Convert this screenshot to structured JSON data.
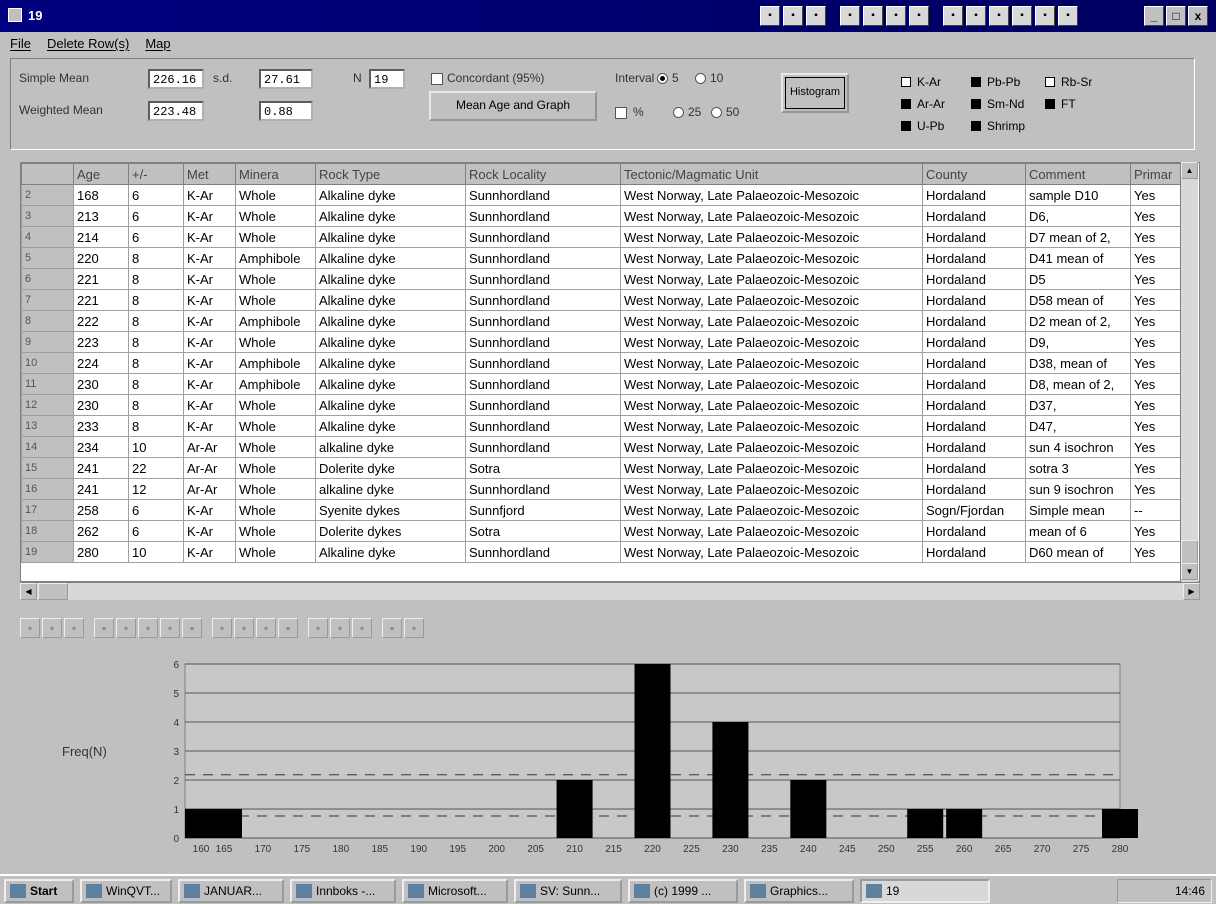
{
  "window": {
    "title": "19",
    "min_label": "_",
    "max_label": "□",
    "close_label": "x"
  },
  "title_icons": [
    "app-1-icon",
    "app-2-icon",
    "app-3-icon",
    "printer-icon",
    "sheet-icon",
    "check-icon",
    "chart-icon",
    "word-icon",
    "excel-icon",
    "doc-icon",
    "graph-icon",
    "search-icon",
    "diamond-icon"
  ],
  "menu": [
    "File",
    "Delete Row(s)",
    "Map"
  ],
  "stats": {
    "simple_mean_label": "Simple Mean",
    "simple_mean": "226.16",
    "sd_label": "s.d.",
    "sd": "27.61",
    "n_label": "N",
    "n": "19",
    "weighted_mean_label": "Weighted Mean",
    "weighted_mean": "223.48",
    "weighted_sd": "0.88",
    "concordant_label": "Concordant (95%)",
    "mean_button": "Mean Age and Graph",
    "interval_label": "Interval",
    "pct_label": "%",
    "interval_options": [
      "5",
      "10",
      "25",
      "50"
    ],
    "interval_selected": "5",
    "histogram_button": "Histogram"
  },
  "methods": [
    {
      "label": "K-Ar",
      "checked": false
    },
    {
      "label": "Pb-Pb",
      "checked": true
    },
    {
      "label": "Rb-Sr",
      "checked": false
    },
    {
      "label": "Ar-Ar",
      "checked": true
    },
    {
      "label": "Sm-Nd",
      "checked": true
    },
    {
      "label": "FT",
      "checked": true
    },
    {
      "label": "U-Pb",
      "checked": true
    },
    {
      "label": "Shrimp",
      "checked": true
    }
  ],
  "table": {
    "headers": [
      "",
      "Age",
      "+/-",
      "Met",
      "Minera",
      "Rock Type",
      "Rock Locality",
      "Tectonic/Magmatic Unit",
      "County",
      "Comment",
      "Primar"
    ],
    "rows": [
      [
        "2",
        "168",
        "6",
        "K-Ar",
        "Whole",
        "Alkaline dyke",
        "Sunnhordland",
        "West Norway, Late Palaeozoic-Mesozoic",
        "Hordaland",
        "sample D10",
        "Yes"
      ],
      [
        "3",
        "213",
        "6",
        "K-Ar",
        "Whole",
        "Alkaline dyke",
        "Sunnhordland",
        "West Norway, Late Palaeozoic-Mesozoic",
        "Hordaland",
        "D6,",
        "Yes"
      ],
      [
        "4",
        "214",
        "6",
        "K-Ar",
        "Whole",
        "Alkaline dyke",
        "Sunnhordland",
        "West Norway, Late Palaeozoic-Mesozoic",
        "Hordaland",
        "D7 mean of 2,",
        "Yes"
      ],
      [
        "5",
        "220",
        "8",
        "K-Ar",
        "Amphibole",
        "Alkaline dyke",
        "Sunnhordland",
        "West Norway, Late Palaeozoic-Mesozoic",
        "Hordaland",
        "D41 mean of",
        "Yes"
      ],
      [
        "6",
        "221",
        "8",
        "K-Ar",
        "Whole",
        "Alkaline dyke",
        "Sunnhordland",
        "West Norway, Late Palaeozoic-Mesozoic",
        "Hordaland",
        "D5",
        "Yes"
      ],
      [
        "7",
        "221",
        "8",
        "K-Ar",
        "Whole",
        "Alkaline dyke",
        "Sunnhordland",
        "West Norway, Late Palaeozoic-Mesozoic",
        "Hordaland",
        "D58 mean of",
        "Yes"
      ],
      [
        "8",
        "222",
        "8",
        "K-Ar",
        "Amphibole",
        "Alkaline dyke",
        "Sunnhordland",
        "West Norway, Late Palaeozoic-Mesozoic",
        "Hordaland",
        "D2 mean of 2,",
        "Yes"
      ],
      [
        "9",
        "223",
        "8",
        "K-Ar",
        "Whole",
        "Alkaline dyke",
        "Sunnhordland",
        "West Norway, Late Palaeozoic-Mesozoic",
        "Hordaland",
        "D9,",
        "Yes"
      ],
      [
        "10",
        "224",
        "8",
        "K-Ar",
        "Amphibole",
        "Alkaline dyke",
        "Sunnhordland",
        "West Norway, Late Palaeozoic-Mesozoic",
        "Hordaland",
        "D38, mean of",
        "Yes"
      ],
      [
        "11",
        "230",
        "8",
        "K-Ar",
        "Amphibole",
        "Alkaline dyke",
        "Sunnhordland",
        "West Norway, Late Palaeozoic-Mesozoic",
        "Hordaland",
        "D8, mean of 2,",
        "Yes"
      ],
      [
        "12",
        "230",
        "8",
        "K-Ar",
        "Whole",
        "Alkaline dyke",
        "Sunnhordland",
        "West Norway, Late Palaeozoic-Mesozoic",
        "Hordaland",
        "D37,",
        "Yes"
      ],
      [
        "13",
        "233",
        "8",
        "K-Ar",
        "Whole",
        "Alkaline dyke",
        "Sunnhordland",
        "West Norway, Late Palaeozoic-Mesozoic",
        "Hordaland",
        "D47,",
        "Yes"
      ],
      [
        "14",
        "234",
        "10",
        "Ar-Ar",
        "Whole",
        "alkaline dyke",
        "Sunnhordland",
        "West Norway, Late Palaeozoic-Mesozoic",
        "Hordaland",
        "sun 4 isochron",
        "Yes"
      ],
      [
        "15",
        "241",
        "22",
        "Ar-Ar",
        "Whole",
        "Dolerite dyke",
        "Sotra",
        "West Norway, Late Palaeozoic-Mesozoic",
        "Hordaland",
        "sotra 3",
        "Yes"
      ],
      [
        "16",
        "241",
        "12",
        "Ar-Ar",
        "Whole",
        "alkaline dyke",
        "Sunnhordland",
        "West Norway, Late Palaeozoic-Mesozoic",
        "Hordaland",
        "sun 9 isochron",
        "Yes"
      ],
      [
        "17",
        "258",
        "6",
        "K-Ar",
        "Whole",
        "Syenite dykes",
        "Sunnfjord",
        "West Norway, Late Palaeozoic-Mesozoic",
        "Sogn/Fjordan",
        "Simple mean",
        "--"
      ],
      [
        "18",
        "262",
        "6",
        "K-Ar",
        "Whole",
        "Dolerite dykes",
        "Sotra",
        "West Norway, Late Palaeozoic-Mesozoic",
        "Hordaland",
        "mean of 6",
        "Yes"
      ],
      [
        "19",
        "280",
        "10",
        "K-Ar",
        "Whole",
        "Alkaline dyke",
        "Sunnhordland",
        "West Norway, Late Palaeozoic-Mesozoic",
        "Hordaland",
        "D60 mean of",
        "Yes"
      ]
    ]
  },
  "chart_toolbar": [
    "bar-chart-icon",
    "table-icon",
    "grid-icon",
    "list-icon",
    "abc-icon",
    "legend-icon",
    "3d-icon",
    "axis-icon",
    "frame-icon",
    "xy-icon",
    "trend-icon",
    "plus-icon",
    "title-icon",
    "palette-icon",
    "pen-icon",
    "help-icon",
    "zoom-icon"
  ],
  "chart_data": {
    "type": "bar",
    "ylabel": "Freq(N)",
    "xlabel": "",
    "categories": [
      "160",
      "165",
      "170",
      "175",
      "180",
      "185",
      "190",
      "195",
      "200",
      "205",
      "210",
      "215",
      "220",
      "225",
      "230",
      "235",
      "240",
      "245",
      "250",
      "255",
      "260",
      "265",
      "270",
      "275",
      "280"
    ],
    "values": [
      1,
      1,
      0,
      0,
      0,
      0,
      0,
      0,
      0,
      0,
      2,
      0,
      6,
      0,
      4,
      0,
      2,
      0,
      0,
      1,
      1,
      0,
      0,
      0,
      1
    ],
    "ylim": [
      0,
      6
    ],
    "yticks": [
      "0",
      "1",
      "2",
      "3",
      "4",
      "5",
      "6"
    ],
    "grid": true,
    "reference_lines": [
      0.76,
      2.18
    ],
    "bar_color": "#000000"
  },
  "taskbar": {
    "items": [
      "Start",
      "WinQVT...",
      "JANUAR...",
      "Innboks -...",
      "Microsoft...",
      "SV: Sunn...",
      "(c) 1999 ...",
      "Graphics...",
      "19"
    ],
    "clock": "14:46"
  }
}
